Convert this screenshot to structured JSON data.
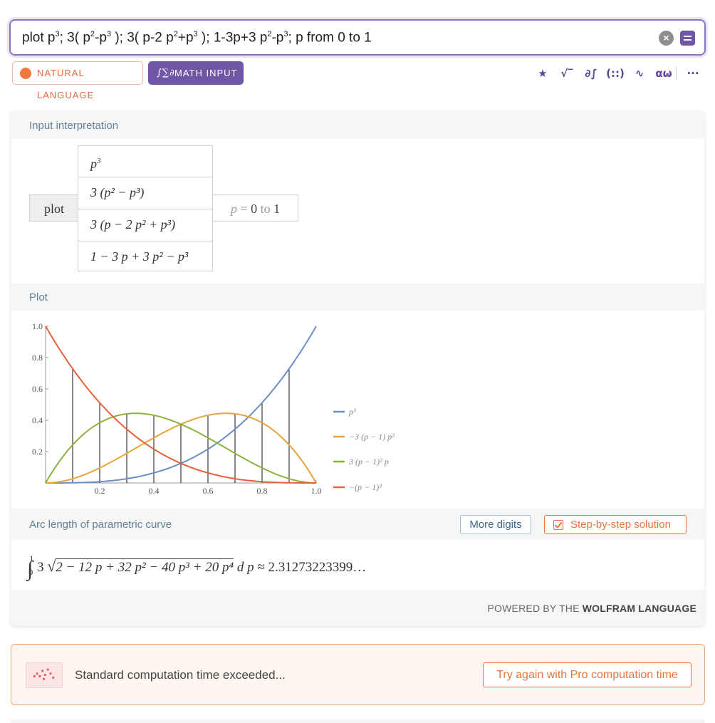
{
  "query": {
    "text_parts": [
      "plot p",
      "3",
      "; 3( p",
      "2",
      "-p",
      "3",
      " ); 3( p-2 p",
      "2",
      "+p",
      "3",
      " ); 1-3p+3 p",
      "2",
      "-p",
      "3",
      "; p from 0 to 1"
    ]
  },
  "modes": {
    "natural_language": "NATURAL LANGUAGE",
    "math_input": "MATH INPUT"
  },
  "toolbar": {
    "icons": [
      "star-icon",
      "sqrt-icon",
      "integral-icon",
      "matrix-icon",
      "waveform-icon",
      "greek-icon",
      "more-icon"
    ],
    "glyphs": [
      "★",
      "√‾",
      "∂∫",
      "(::)",
      "∿",
      "αω",
      "···"
    ]
  },
  "pods": {
    "input_interpretation": {
      "title": "Input interpretation",
      "plot_label": "plot",
      "expressions": [
        "p³",
        "3 (p² − p³)",
        "3 (p − 2 p² + p³)",
        "1 − 3 p + 3 p² − p³"
      ],
      "range_var": "p",
      "range_eq": " = ",
      "range_from": "0",
      "range_to_word": " to ",
      "range_to": "1"
    },
    "plot": {
      "title": "Plot"
    },
    "arc_length": {
      "title": "Arc length of parametric curve",
      "more_digits": "More digits",
      "step_by_step": "Step-by-step solution",
      "expression": "3 √(2 − 12 p + 32 p² − 40 p³ + 20 p⁴) d p ≈ 2.31273223399…",
      "lower_limit": "0",
      "upper_limit": "1",
      "integrand_coef": "3",
      "radicand": "2 − 12 p + 32 p² − 40 p³ + 20 p⁴",
      "differential": "d p",
      "approx": "≈",
      "value": "2.31273223399…"
    }
  },
  "footer": {
    "powered_prefix": "POWERED BY THE ",
    "powered_brand": "WOLFRAM LANGUAGE"
  },
  "banner": {
    "message": "Standard computation time exceeded...",
    "button": "Try again with Pro computation time"
  },
  "colors": {
    "accent_purple": "#6f57a6",
    "accent_orange": "#e8753d",
    "label_blue": "#5f8196"
  },
  "chart_data": {
    "type": "line",
    "xlim": [
      0,
      1.0
    ],
    "ylim": [
      0,
      1.0
    ],
    "x_ticks": [
      "0.2",
      "0.4",
      "0.6",
      "0.8",
      "1.0"
    ],
    "y_ticks": [
      "0.2",
      "0.4",
      "0.6",
      "0.8",
      "1.0"
    ],
    "grid": false,
    "legend_placement": "right",
    "series": [
      {
        "name": "p³",
        "color": "#6b8fc5",
        "x": [
          0,
          0.1,
          0.2,
          0.3,
          0.4,
          0.5,
          0.6,
          0.7,
          0.8,
          0.9,
          1.0
        ],
        "values": [
          0,
          0.001,
          0.008,
          0.027,
          0.064,
          0.125,
          0.216,
          0.343,
          0.512,
          0.729,
          1.0
        ]
      },
      {
        "name": "−3 (p − 1) p²",
        "color": "#e6a43c",
        "x": [
          0,
          0.1,
          0.2,
          0.3,
          0.4,
          0.5,
          0.6,
          0.7,
          0.8,
          0.9,
          1.0
        ],
        "values": [
          0,
          0.027,
          0.096,
          0.189,
          0.288,
          0.375,
          0.432,
          0.441,
          0.384,
          0.243,
          0
        ]
      },
      {
        "name": "3 (p − 1)² p",
        "color": "#8bb23e",
        "x": [
          0,
          0.1,
          0.2,
          0.3,
          0.4,
          0.5,
          0.6,
          0.7,
          0.8,
          0.9,
          1.0
        ],
        "values": [
          0,
          0.243,
          0.384,
          0.441,
          0.432,
          0.375,
          0.288,
          0.189,
          0.096,
          0.027,
          0
        ]
      },
      {
        "name": "−(p − 1)³",
        "color": "#e8603c",
        "x": [
          0,
          0.1,
          0.2,
          0.3,
          0.4,
          0.5,
          0.6,
          0.7,
          0.8,
          0.9,
          1.0
        ],
        "values": [
          1.0,
          0.729,
          0.512,
          0.343,
          0.216,
          0.125,
          0.064,
          0.027,
          0.008,
          0.001,
          0
        ]
      }
    ],
    "vertical_lines": {
      "x": [
        0.1,
        0.2,
        0.3,
        0.4,
        0.5,
        0.6,
        0.7,
        0.8,
        0.9
      ],
      "top": [
        0.729,
        0.512,
        0.441,
        0.432,
        0.375,
        0.432,
        0.441,
        0.512,
        0.729
      ]
    }
  }
}
